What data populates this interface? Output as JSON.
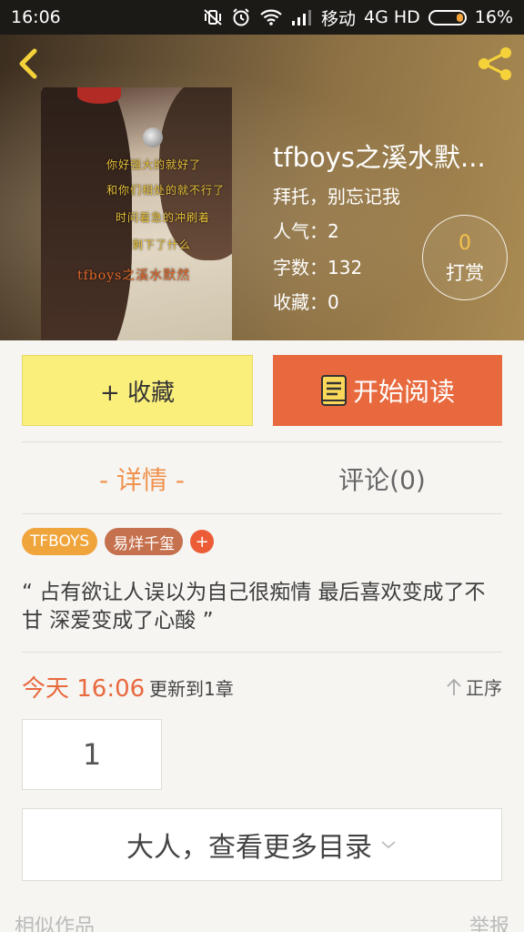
{
  "status_bar": {
    "time": "16:06",
    "carrier": "移动",
    "network": "4G HD",
    "battery": "16%"
  },
  "book": {
    "title": "tfboys之溪水默...",
    "subtitle": "拜托，别忘记我",
    "popularity": "人气：2",
    "word_count": "字数：132",
    "favorites": "收藏：0",
    "tip_count": "0",
    "tip_label": "打赏",
    "cover_lines": [
      "你好强大的就好了",
      "和你们相处的就不行了",
      "时间着急的冲刷着",
      "剩下了什么",
      "tfboys之溪水默然"
    ]
  },
  "actions": {
    "favorite_label": "+ 收藏",
    "read_label": "开始阅读"
  },
  "tabs": {
    "detail": "- 详情 -",
    "comments": "评论(0)"
  },
  "tags": [
    "TFBOYS",
    "易烊千玺",
    "+"
  ],
  "quote": "“ 占有欲让人误以为自己很痴情 最后喜欢变成了不甘 深爱变成了心酸 ”",
  "update": {
    "time": "今天 16:06",
    "text": "更新到1章",
    "sort": "正序"
  },
  "chapters": {
    "first": "1",
    "more_label": "大人，查看更多目录"
  },
  "footer": {
    "similar": "相似作品",
    "report": "举报"
  },
  "colors": {
    "accent": "#e8693e",
    "favorite_bg": "#fbef7c",
    "tag_primary": "#f0a53c",
    "tag_secondary": "#c5714d",
    "tip_number": "#f5c14c"
  }
}
